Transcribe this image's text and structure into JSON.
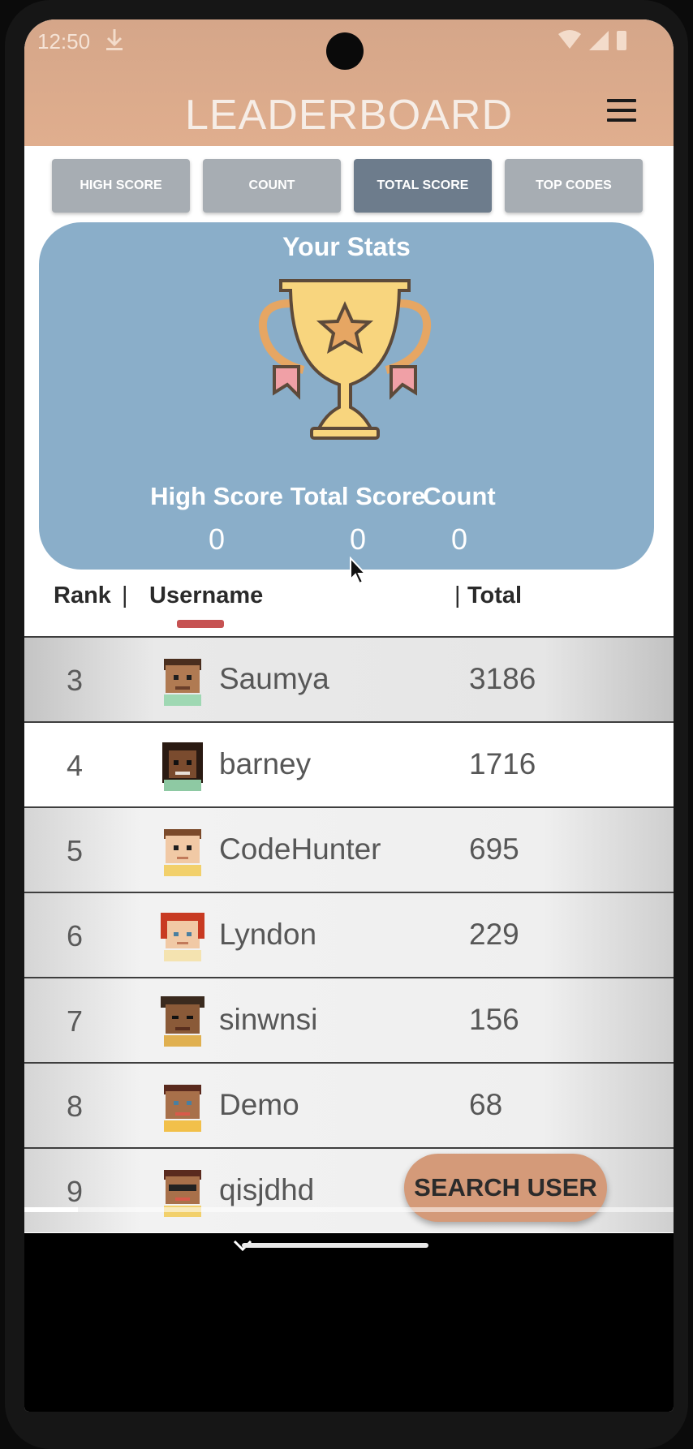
{
  "status_bar": {
    "time": "12:50"
  },
  "app_bar": {
    "title": "LEADERBOARD"
  },
  "tabs": [
    {
      "label": "HIGH SCORE"
    },
    {
      "label": "COUNT"
    },
    {
      "label": "TOTAL SCORE",
      "active": true
    },
    {
      "label": "TOP CODES"
    }
  ],
  "stats": {
    "title": "Your Stats",
    "high_score_label": "High Score",
    "high_score": "0",
    "total_score_label": "Total Score",
    "total_score": "0",
    "count_label": "Count",
    "count": "0"
  },
  "list_header": {
    "rank": "Rank",
    "username": "Username",
    "total": "Total"
  },
  "rows": [
    {
      "rank": "3",
      "username": "Saumya",
      "total": "3186"
    },
    {
      "rank": "4",
      "username": "barney",
      "total": "1716"
    },
    {
      "rank": "5",
      "username": "CodeHunter",
      "total": "695"
    },
    {
      "rank": "6",
      "username": "Lyndon",
      "total": "229"
    },
    {
      "rank": "7",
      "username": "sinwnsi",
      "total": "156"
    },
    {
      "rank": "8",
      "username": "Demo",
      "total": "68"
    },
    {
      "rank": "9",
      "username": "qisjdhd",
      "total": ""
    }
  ],
  "search_button": {
    "label": "SEARCH USER"
  },
  "colors": {
    "accent": "#d9a789",
    "card": "#8aaec9",
    "active_tab": "#6d7c8c",
    "tab": "#a7adb3"
  }
}
